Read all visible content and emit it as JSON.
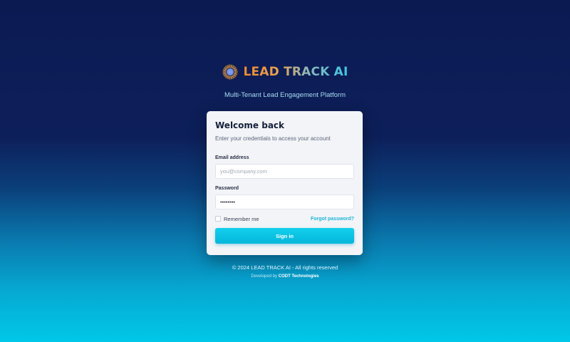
{
  "brand": {
    "name": "LEAD TRACK AI",
    "tagline": "Multi-Tenant Lead Engagement Platform",
    "logo_icon": "sunburst-logo-icon"
  },
  "login_card": {
    "title": "Welcome back",
    "subtitle": "Enter your credentials to access your account",
    "email": {
      "label": "Email address",
      "placeholder": "you@company.com",
      "value": ""
    },
    "password": {
      "label": "Password",
      "value": "••••••••"
    },
    "remember_label": "Remember me",
    "remember_checked": false,
    "forgot_label": "Forgot password?",
    "signin_label": "Sign in"
  },
  "footer": {
    "copyright": "© 2024 LEAD TRACK AI - All rights reserved",
    "developed_prefix": "Developed by",
    "developer": "CODT Technologies"
  },
  "colors": {
    "accent": "#05b6db",
    "background_top": "#0c1a52",
    "background_bottom": "#00c8e8",
    "card": "#f2f4f8"
  }
}
